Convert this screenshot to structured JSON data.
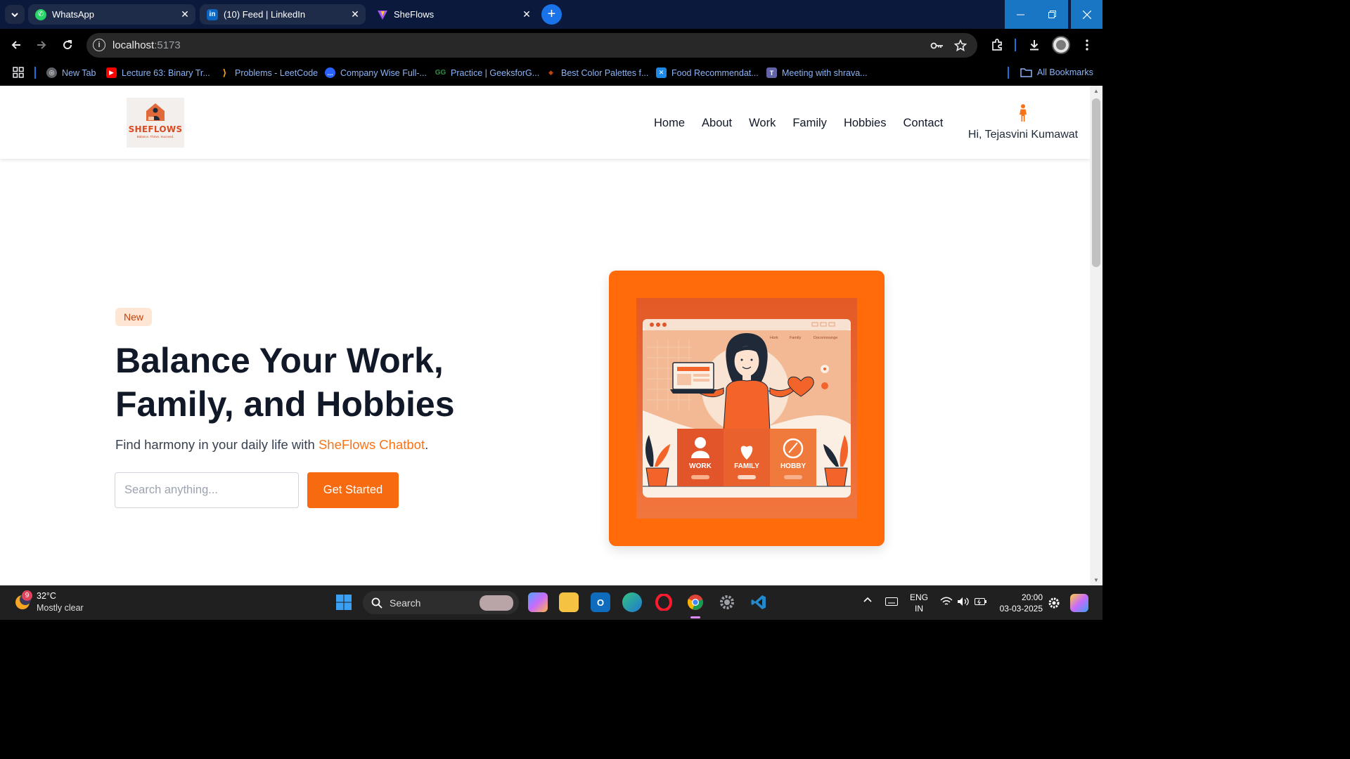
{
  "browser": {
    "tabs": [
      {
        "title": "WhatsApp",
        "icon": "whatsapp-icon",
        "color": "#25d366"
      },
      {
        "title": "(10) Feed | LinkedIn",
        "icon": "linkedin-icon",
        "color": "#0a66c2"
      },
      {
        "title": "SheFlows",
        "icon": "vite-icon",
        "color": "#a855f7"
      }
    ],
    "new_tab_label": "+",
    "url": {
      "host": "localhost",
      "port": ":5173"
    },
    "bookmarks": [
      {
        "label": "New Tab",
        "icon": "globe-icon",
        "color": "#5f6368"
      },
      {
        "label": "Lecture 63: Binary Tr...",
        "icon": "youtube-icon",
        "color": "#ff0000"
      },
      {
        "label": "Problems - LeetCode",
        "icon": "leetcode-icon",
        "color": "#ffa116"
      },
      {
        "label": "Company Wise Full-...",
        "icon": "chat-icon",
        "color": "#2962ff"
      },
      {
        "label": "Practice | GeeksforG...",
        "icon": "gfg-icon",
        "color": "#2f8d46"
      },
      {
        "label": "Best Color Palettes f...",
        "icon": "palette-icon",
        "color": "#c2410c"
      },
      {
        "label": "Food Recommendat...",
        "icon": "food-icon",
        "color": "#1e88e5"
      },
      {
        "label": "Meeting with shrava...",
        "icon": "teams-icon",
        "color": "#6264a7"
      }
    ],
    "all_bookmarks": "All Bookmarks"
  },
  "site": {
    "logo": {
      "word": "SHEFLOWS",
      "tagline": "Balance. Thrive. Succeed."
    },
    "nav": [
      "Home",
      "About",
      "Work",
      "Family",
      "Hobbies",
      "Contact"
    ],
    "user": {
      "greeting": "Hi, Tejasvini Kumawat"
    },
    "hero": {
      "badge": "New",
      "title": "Balance Your Work, Family, and Hobbies",
      "subtitle_prefix": "Find harmony in your daily life with ",
      "subtitle_brand": "SheFlows Chatbot",
      "subtitle_suffix": ".",
      "search_placeholder": "Search anything...",
      "cta": "Get Started",
      "illustration": {
        "menu": [
          "Hork",
          "Family",
          "Doconnnunge"
        ],
        "cards": [
          "WORK",
          "FAMILY",
          "HOBBY"
        ]
      }
    },
    "colors": {
      "accent": "#f86a0f",
      "text": "#111827",
      "badge_bg": "#fde7d4"
    }
  },
  "taskbar": {
    "weather": {
      "temp": "32°C",
      "condition": "Mostly clear",
      "badge": "9"
    },
    "search_label": "Search",
    "language": [
      "ENG",
      "IN"
    ],
    "time": "20:00",
    "date": "03-03-2025"
  }
}
